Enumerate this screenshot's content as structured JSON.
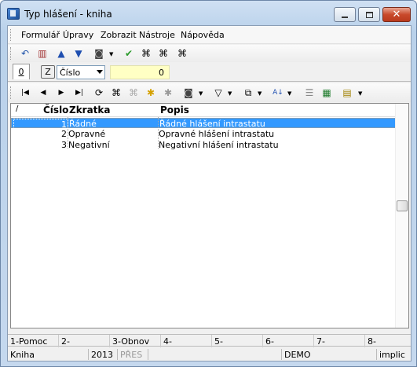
{
  "window": {
    "title": "Typ hlášení - kniha"
  },
  "menu": [
    "Formulář",
    "Úpravy",
    "Zobrazit",
    "Nástroje",
    "Nápověda"
  ],
  "toolbar1": {
    "icons": [
      "undo-icon",
      "book-icon",
      "arrow-up-icon",
      "arrow-down-icon",
      "camera-icon",
      "check-green-icon",
      "binoculars-icon",
      "binoculars-search-icon",
      "binoculars-next-icon"
    ]
  },
  "filter": {
    "tab_label": "0",
    "z_button": "Z",
    "select_value": "Číslo",
    "number_value": "0"
  },
  "toolbar2": {
    "icons": [
      "first-record-icon",
      "prev-record-icon",
      "next-record-icon",
      "last-record-icon",
      "refresh-icon",
      "binoculars-icon",
      "binoculars-disabled-icon",
      "star-add-icon",
      "star-remove-icon",
      "camera-icon",
      "filter-icon",
      "copy-icon",
      "sort-az-icon",
      "list-icon",
      "excel-icon",
      "columns-icon"
    ]
  },
  "grid": {
    "columns": {
      "marker": "/",
      "cislo": "Číslo",
      "zkratka": "Zkratka",
      "popis": "Popis"
    },
    "rows": [
      {
        "cislo": "1",
        "zkratka": "Řádné",
        "popis": "Řádné hlášení intrastatu"
      },
      {
        "cislo": "2",
        "zkratka": "Opravné",
        "popis": "Opravné hlášení intrastatu"
      },
      {
        "cislo": "3",
        "zkratka": "Negativní",
        "popis": "Negativní hlášení intrastatu"
      }
    ],
    "selected_row": 0
  },
  "fkeys": [
    "1-Pomoc",
    "2-",
    "3-Obnov",
    "4-",
    "5-",
    "6-",
    "7-",
    "8-"
  ],
  "status": {
    "mode": "Kniha",
    "year": "2013",
    "pres": "PŘES",
    "db": "DEMO",
    "extra": "implic"
  },
  "colors": {
    "selection": "#3399ff",
    "number_field": "#ffffc4",
    "close_button": "#c94a2c"
  }
}
